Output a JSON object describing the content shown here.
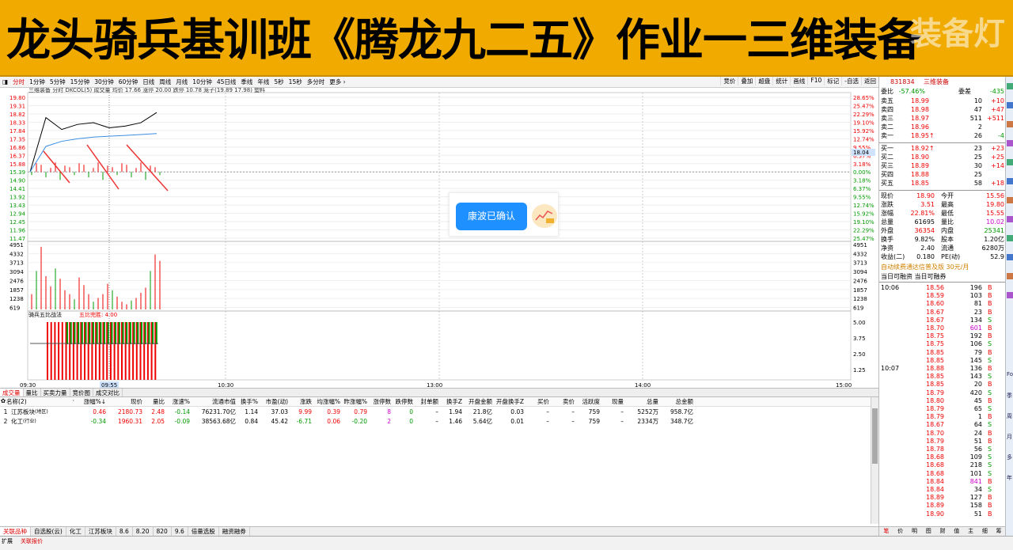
{
  "banner": {
    "title": "龙头骑兵基训班《腾龙九二五》作业一三维装备",
    "watermark": "装备灯"
  },
  "period": {
    "items": [
      "分时",
      "1分钟",
      "5分钟",
      "15分钟",
      "30分钟",
      "60分钟",
      "日线",
      "周线",
      "月线",
      "10分钟",
      "45日线",
      "季线",
      "年线",
      "5秒",
      "15秒",
      "多分时",
      "更多 ›"
    ],
    "tools": [
      "竞价",
      "叠加",
      "超盘",
      "统计",
      "画线",
      "F10",
      "标记",
      "-自选",
      "返回"
    ]
  },
  "chart": {
    "header": "三维装备  分时 DKCOL(5) 成交量  均价 17.66 涨停 20.00 跌停 10.78 笼子(19.89 17.98) 塑料",
    "price_ticks": [
      "19.80",
      "19.31",
      "18.82",
      "18.33",
      "17.84",
      "17.35",
      "16.86",
      "16.37",
      "15.88",
      "15.39",
      "14.90",
      "14.41",
      "13.92",
      "13.43",
      "12.94",
      "12.45",
      "11.96",
      "11.47"
    ],
    "pct_ticks": [
      "28.65%",
      "25.47%",
      "22.29%",
      "19.10%",
      "15.92%",
      "12.74%",
      "9.55%",
      "6.37%",
      "3.18%",
      "0.00%",
      "3.18%",
      "6.37%",
      "9.55%",
      "12.74%",
      "15.92%",
      "19.10%",
      "22.29%",
      "25.47%"
    ],
    "current_pct": "18.04",
    "vol_ticks": [
      "4951",
      "4332",
      "3713",
      "3094",
      "2476",
      "1857",
      "1238",
      "619"
    ],
    "ind_label": "骑兵五比战法",
    "ind_label2": "五比完胜: 4.00",
    "ind_ticks": [
      "5.00",
      "3.75",
      "2.50",
      "1.25"
    ],
    "time_ticks": [
      "09:30",
      "10:30",
      "13:00",
      "14:00",
      "15:00"
    ],
    "cursor_time": "09:55",
    "index_label": "指标*"
  },
  "toast": {
    "label": "康波已确认"
  },
  "tabs": [
    "成交量",
    "量比",
    "买卖力量",
    "竞价图",
    "成交对比"
  ],
  "table": {
    "headers": [
      "名称(2)",
      "·",
      "涨幅%↓",
      "现价",
      "量比",
      "涨速%",
      "流通市值",
      "换手%",
      "市盈(动)",
      "涨跌",
      "均涨幅%",
      "昨涨幅%",
      "涨停数",
      "跌停数",
      "封单额",
      "换手Z",
      "开盘金额",
      "开盘换手Z",
      "买价",
      "卖价",
      "活跃度",
      "现量",
      "总量",
      "总金额"
    ],
    "rows": [
      {
        "idx": "1",
        "name": "江苏板块",
        "tag": "(地区)",
        "cells": [
          "0.46",
          "2180.73",
          "2.48",
          "-0.14",
          "76231.70亿",
          "1.14",
          "37.03",
          "9.99",
          "0.39",
          "0.79",
          "8",
          "0",
          "–",
          "1.94",
          "21.8亿",
          "0.03",
          "–",
          "–",
          "759",
          "–",
          "5252万",
          "958.7亿"
        ]
      },
      {
        "idx": "2",
        "name": "化工",
        "tag": "(行业)",
        "cells": [
          "-0.34",
          "1960.31",
          "2.05",
          "-0.09",
          "38563.68亿",
          "0.84",
          "45.42",
          "-6.71",
          "0.06",
          "-0.20",
          "2",
          "0",
          "–",
          "1.46",
          "5.64亿",
          "0.01",
          "–",
          "–",
          "759",
          "–",
          "2334万",
          "348.7亿"
        ]
      }
    ]
  },
  "bottom_tabs": [
    "关联品种",
    "自选股(云)",
    "化工",
    "江苏板块",
    "8.6",
    "8.20",
    "820",
    "9.6",
    "倍量选股",
    "融资融券"
  ],
  "bottom_status": [
    "扩展",
    "关联报价"
  ],
  "right": {
    "code": "831834",
    "name": "三维装备",
    "weibi": "-57.46%",
    "weicha": "-435",
    "sells": [
      {
        "label": "卖五",
        "price": "18.99",
        "vol": "10",
        "chg": "+10"
      },
      {
        "label": "卖四",
        "price": "18.98",
        "vol": "47",
        "chg": "+47"
      },
      {
        "label": "卖三",
        "price": "18.97",
        "vol": "511",
        "chg": "+511"
      },
      {
        "label": "卖二",
        "price": "18.96",
        "vol": "2",
        "chg": ""
      },
      {
        "label": "卖一",
        "price": "18.95↑",
        "vol": "26",
        "chg": "-4"
      }
    ],
    "buys": [
      {
        "label": "买一",
        "price": "18.92↑",
        "vol": "23",
        "chg": "+23"
      },
      {
        "label": "买二",
        "price": "18.90",
        "vol": "25",
        "chg": "+25"
      },
      {
        "label": "买三",
        "price": "18.89",
        "vol": "30",
        "chg": "+14"
      },
      {
        "label": "买四",
        "price": "18.88",
        "vol": "25",
        "chg": ""
      },
      {
        "label": "买五",
        "price": "18.85",
        "vol": "58",
        "chg": "+18"
      }
    ],
    "stats": [
      [
        "现价",
        "18.90",
        "今开",
        "15.56"
      ],
      [
        "涨跌",
        "3.51",
        "最高",
        "19.80"
      ],
      [
        "涨幅",
        "22.81%",
        "最低",
        "15.55"
      ],
      [
        "总量",
        "61695",
        "量比",
        "10.02"
      ],
      [
        "外盘",
        "36354",
        "内盘",
        "25341"
      ],
      [
        "换手",
        "9.82%",
        "股本",
        "1.20亿"
      ],
      [
        "净资",
        "2.40",
        "流通",
        "6280万"
      ],
      [
        "收益(二)",
        "0.180",
        "PE(动)",
        "52.9"
      ]
    ],
    "promo": "自动续费通达信普及版  30元/月",
    "margin": "当日可融资  当日可融券",
    "ticks": [
      {
        "time": "10:06",
        "price": "18.56",
        "vol": "196",
        "bs": "B"
      },
      {
        "time": "",
        "price": "18.59",
        "vol": "103",
        "bs": "B"
      },
      {
        "time": "",
        "price": "18.60",
        "vol": "81",
        "bs": "B"
      },
      {
        "time": "",
        "price": "18.67",
        "vol": "23",
        "bs": "B"
      },
      {
        "time": "",
        "price": "18.67",
        "vol": "134",
        "bs": "S"
      },
      {
        "time": "",
        "price": "18.70",
        "vol": "601",
        "bs": "B"
      },
      {
        "time": "",
        "price": "18.75",
        "vol": "192",
        "bs": "B"
      },
      {
        "time": "",
        "price": "18.75",
        "vol": "106",
        "bs": "S"
      },
      {
        "time": "",
        "price": "18.85",
        "vol": "79",
        "bs": "B"
      },
      {
        "time": "",
        "price": "18.85",
        "vol": "145",
        "bs": "S"
      },
      {
        "time": "10:07",
        "price": "18.88",
        "vol": "136",
        "bs": "B"
      },
      {
        "time": "",
        "price": "18.85",
        "vol": "143",
        "bs": "S"
      },
      {
        "time": "",
        "price": "18.85",
        "vol": "20",
        "bs": "B"
      },
      {
        "time": "",
        "price": "18.79",
        "vol": "420",
        "bs": "S"
      },
      {
        "time": "",
        "price": "18.80",
        "vol": "45",
        "bs": "B"
      },
      {
        "time": "",
        "price": "18.79",
        "vol": "65",
        "bs": "S"
      },
      {
        "time": "",
        "price": "18.79",
        "vol": "1",
        "bs": "B"
      },
      {
        "time": "",
        "price": "18.67",
        "vol": "64",
        "bs": "S"
      },
      {
        "time": "",
        "price": "18.70",
        "vol": "24",
        "bs": "B"
      },
      {
        "time": "",
        "price": "18.79",
        "vol": "51",
        "bs": "B"
      },
      {
        "time": "",
        "price": "18.78",
        "vol": "56",
        "bs": "S"
      },
      {
        "time": "",
        "price": "18.68",
        "vol": "109",
        "bs": "S"
      },
      {
        "time": "",
        "price": "18.68",
        "vol": "218",
        "bs": "S"
      },
      {
        "time": "",
        "price": "18.68",
        "vol": "101",
        "bs": "S"
      },
      {
        "time": "",
        "price": "18.84",
        "vol": "841",
        "bs": "B"
      },
      {
        "time": "",
        "price": "18.84",
        "vol": "34",
        "bs": "S"
      },
      {
        "time": "",
        "price": "18.89",
        "vol": "127",
        "bs": "B"
      },
      {
        "time": "",
        "price": "18.89",
        "vol": "158",
        "bs": "B"
      },
      {
        "time": "",
        "price": "18.90",
        "vol": "51",
        "bs": "B"
      }
    ],
    "bottom_tabs": [
      "笔",
      "价",
      "明",
      "图",
      "财",
      "值",
      "主",
      "细",
      "筹"
    ],
    "strip_labels": [
      "Fo",
      "季",
      "周",
      "月",
      "多",
      "年"
    ]
  },
  "colors": {
    "up": "#e00000",
    "down": "#009000",
    "price_line": "#000000",
    "avg_line": "#3a8ee6",
    "accent": "#f0aa00"
  },
  "chart_data": {
    "type": "line",
    "x": [
      "09:30",
      "09:35",
      "09:40",
      "09:45",
      "09:50",
      "09:55",
      "10:00",
      "10:05",
      "10:07"
    ],
    "series": [
      {
        "values": [
          15.39,
          18.6,
          17.9,
          18.2,
          18.3,
          18.0,
          18.1,
          18.3,
          18.9
        ]
      },
      {
        "values": [
          15.39,
          16.9,
          17.2,
          17.35,
          17.45,
          17.5,
          17.55,
          17.6,
          17.66
        ]
      }
    ],
    "volume": [
      1200,
      3000,
      4900,
      2600,
      1800,
      3200,
      2400,
      1500,
      1200,
      800,
      2500,
      1900,
      1200,
      600,
      900,
      1200,
      2000,
      1500,
      1000,
      600,
      400,
      700,
      900,
      1300,
      1700,
      3000,
      4300,
      3800
    ],
    "ind_values": {
      "red_bars": 30,
      "green_bars": 28,
      "level": 4.0
    },
    "ylim": [
      11.47,
      19.8
    ]
  }
}
